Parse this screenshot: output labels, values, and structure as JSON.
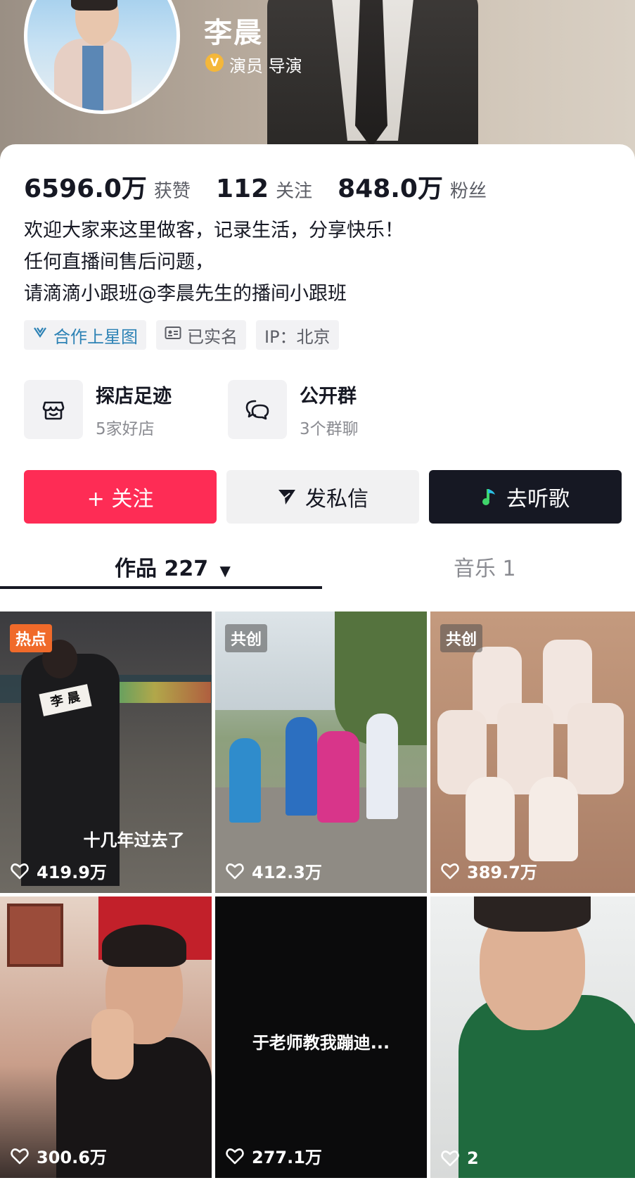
{
  "profile": {
    "name": "李晨",
    "verify_badge": "V",
    "roles": "演员 导演"
  },
  "stats": [
    {
      "value": "6596.0万",
      "label": "获赞"
    },
    {
      "value": "112",
      "label": "关注"
    },
    {
      "value": "848.0万",
      "label": "粉丝"
    }
  ],
  "bio": {
    "line1": "欢迎大家来这里做客，记录生活，分享快乐！",
    "line2": "任何直播间售后问题，",
    "line3": "请滴滴小跟班@李晨先生的播间小跟班"
  },
  "tags": {
    "star": "合作上星图",
    "realname": "已实名",
    "ip": "IP：北京"
  },
  "shortcuts": [
    {
      "title": "探店足迹",
      "sub": "5家好店",
      "icon": "shop-icon"
    },
    {
      "title": "公开群",
      "sub": "3个群聊",
      "icon": "chat-bubble-icon"
    }
  ],
  "actions": {
    "follow": "+ 关注",
    "message": "发私信",
    "music": "去听歌"
  },
  "tabs": {
    "works": "作品 227",
    "works_arrow": "▼",
    "music": "音乐 1"
  },
  "videos": [
    {
      "tag": "热点",
      "likes": "419.9万",
      "caption": "十几年过去了",
      "jersey": "李 晨"
    },
    {
      "tag": "共创",
      "likes": "412.3万"
    },
    {
      "tag": "共创",
      "likes": "389.7万"
    },
    {
      "likes": "300.6万"
    },
    {
      "likes": "277.1万",
      "caption": "于老师教我蹦迪..."
    },
    {
      "likes": "2"
    }
  ],
  "colors": {
    "follow_red": "#fe2c55",
    "dark": "#161823",
    "star_blue": "#2d82b5",
    "hot_orange": "#f06a2a"
  }
}
